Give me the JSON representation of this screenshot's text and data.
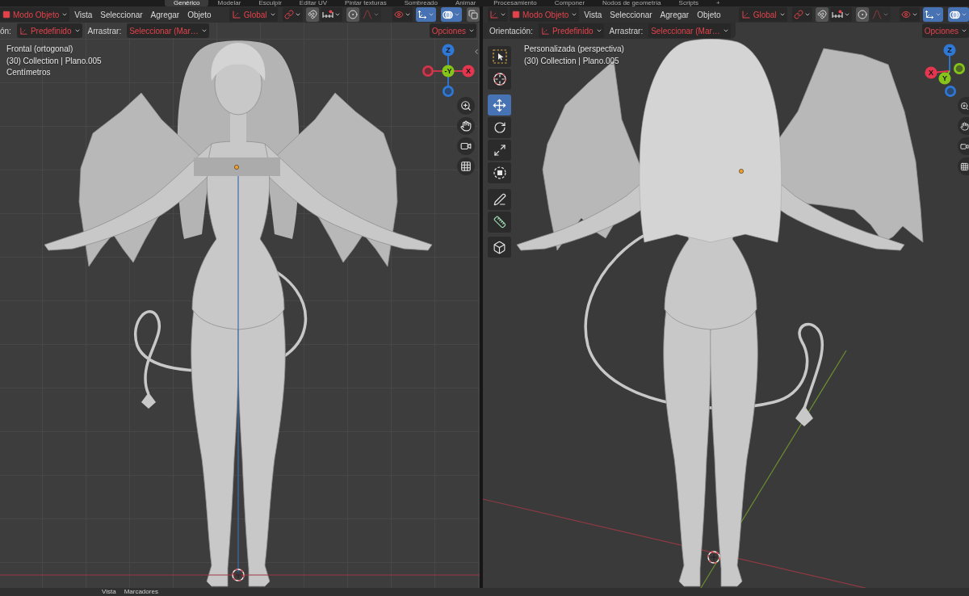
{
  "workspace_tabs": [
    {
      "label": "Genérico",
      "selected": true
    },
    {
      "label": "Modelar",
      "selected": false
    },
    {
      "label": "Esculpir",
      "selected": false
    },
    {
      "label": "Editar UV",
      "selected": false
    },
    {
      "label": "Pintar texturas",
      "selected": false
    },
    {
      "label": "Sombreado",
      "selected": false
    },
    {
      "label": "Animar",
      "selected": false
    },
    {
      "label": "Procesamiento",
      "selected": false
    },
    {
      "label": "Componer",
      "selected": false
    },
    {
      "label": "Nodos de geometría",
      "selected": false
    },
    {
      "label": "Scripts",
      "selected": false
    },
    {
      "label": "+",
      "selected": false
    }
  ],
  "viewports": [
    {
      "kind": "orthographic",
      "header": [
        {
          "kind": "mode",
          "label": "Modo Objeto"
        },
        {
          "kind": "menu",
          "label": "Vista"
        },
        {
          "kind": "menu",
          "label": "Seleccionar"
        },
        {
          "kind": "menu",
          "label": "Agregar"
        },
        {
          "kind": "menu",
          "label": "Objeto"
        },
        {
          "kind": "orientation",
          "label": "Global"
        },
        {
          "kind": "snap_target"
        },
        {
          "kind": "snap",
          "on": false
        },
        {
          "kind": "snap_increment"
        },
        {
          "kind": "proportional",
          "on": false
        },
        {
          "kind": "falloff",
          "disabled": true
        },
        {
          "kind": "visibility"
        },
        {
          "kind": "gizmos",
          "on": true
        },
        {
          "kind": "overlays",
          "on": true
        },
        {
          "kind": "xray",
          "on": false
        }
      ],
      "tool_settings": {
        "orientation_label": "ón:",
        "orientation": "Predefinido",
        "drag_label": "Arrastrar:",
        "drag": "Seleccionar (Mar…",
        "options": "Opciones"
      },
      "view_info": [
        "Frontal (ortogonal)",
        "(30) Collection | Plano.005",
        "Centímetros"
      ],
      "gizmo": [
        {
          "label": "Z",
          "kind": "positive",
          "color": "#2f78d6"
        },
        {
          "kind": "negative",
          "color": "#d0374b"
        },
        {
          "label": "-Y",
          "kind": "positive",
          "color": "#86c41a"
        },
        {
          "label": "X",
          "kind": "positive",
          "color": "#e2374f"
        },
        {
          "kind": "negative",
          "color": "#2f78d6"
        }
      ],
      "sidebar_toggle": true
    },
    {
      "kind": "perspective",
      "header": [
        {
          "kind": "editor_type"
        },
        {
          "kind": "mode",
          "label": "Modo Objeto"
        },
        {
          "kind": "menu",
          "label": "Vista"
        },
        {
          "kind": "menu",
          "label": "Seleccionar"
        },
        {
          "kind": "menu",
          "label": "Agregar"
        },
        {
          "kind": "menu",
          "label": "Objeto"
        },
        {
          "kind": "orientation",
          "label": "Global"
        },
        {
          "kind": "snap_target"
        },
        {
          "kind": "snap",
          "on": false
        },
        {
          "kind": "snap_increment"
        },
        {
          "kind": "proportional",
          "on": false
        },
        {
          "kind": "falloff",
          "disabled": true
        },
        {
          "kind": "visibility"
        },
        {
          "kind": "gizmos",
          "on": true
        },
        {
          "kind": "overlays",
          "on": true
        }
      ],
      "tool_settings": {
        "orientation_label": "Orientación:",
        "orientation": "Predefinido",
        "drag_label": "Arrastrar:",
        "drag": "Seleccionar (Mar…",
        "options": "Opciones"
      },
      "view_info": [
        "Personalizada (perspectiva)",
        "(30) Collection | Plano.005"
      ],
      "tools": [
        {
          "kind": "select_box",
          "selected": false
        },
        {
          "kind": "cursor",
          "selected": false
        },
        {
          "kind": "move",
          "selected": true
        },
        {
          "kind": "rotate",
          "selected": false
        },
        {
          "kind": "scale",
          "selected": false
        },
        {
          "kind": "transform",
          "selected": false
        },
        {
          "kind": "annotate",
          "selected": false
        },
        {
          "kind": "measure",
          "selected": false
        },
        {
          "kind": "add_cube",
          "selected": false
        }
      ],
      "gizmo": [
        {
          "label": "Z",
          "kind": "positive",
          "color": "#2f78d6"
        },
        {
          "label": "X",
          "kind": "positive",
          "color": "#e2374f"
        },
        {
          "kind": "negative",
          "color": "#86c41a"
        },
        {
          "label": "Y",
          "kind": "positive",
          "color": "#86c41a"
        },
        {
          "kind": "negative",
          "color": "#2f78d6"
        }
      ]
    }
  ],
  "timeline": {
    "menus": [
      "Vista",
      "Marcadores"
    ]
  }
}
